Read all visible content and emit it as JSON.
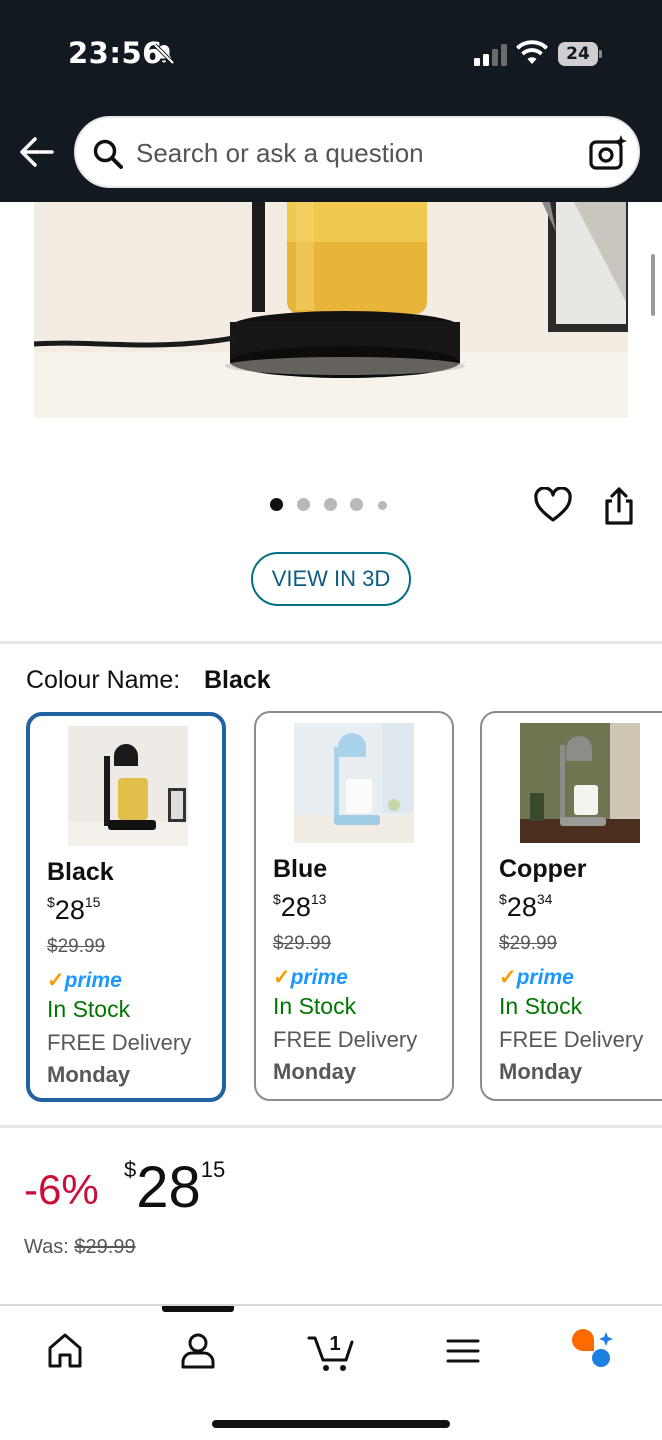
{
  "status_bar": {
    "time": "23:56",
    "battery_level": "24",
    "icons": [
      "bell-slash-icon",
      "cellular-signal-icon",
      "wifi-icon",
      "battery-icon"
    ]
  },
  "header": {
    "search_placeholder": "Search or ask a question",
    "icons": [
      "back-arrow-icon",
      "search-icon",
      "camera-search-icon"
    ]
  },
  "gallery": {
    "dot_count": 5,
    "active_dot": 1,
    "icons": [
      "heart-icon",
      "share-icon"
    ],
    "view_3d_label": "VIEW IN 3D"
  },
  "variations": {
    "label": "Colour Name:",
    "selected": "Black",
    "options": [
      {
        "name": "Black",
        "currency": "$",
        "whole": "28",
        "fraction": "15",
        "was": "$29.99",
        "prime": "prime",
        "stock": "In Stock",
        "delivery": "FREE Delivery",
        "day": "Monday",
        "selected": true
      },
      {
        "name": "Blue",
        "currency": "$",
        "whole": "28",
        "fraction": "13",
        "was": "$29.99",
        "prime": "prime",
        "stock": "In Stock",
        "delivery": "FREE Delivery",
        "day": "Monday",
        "selected": false
      },
      {
        "name": "Copper",
        "currency": "$",
        "whole": "28",
        "fraction": "34",
        "was": "$29.99",
        "prime": "prime",
        "stock": "In Stock",
        "delivery": "FREE Delivery",
        "day": "Monday",
        "selected": false
      }
    ]
  },
  "pricing": {
    "discount": "-6%",
    "currency": "$",
    "whole": "28",
    "fraction": "15",
    "was_label": "Was:",
    "was_price": "$29.99"
  },
  "bottom_nav": {
    "items": [
      "home-icon",
      "account-icon",
      "cart-icon",
      "menu-icon",
      "rufus-assistant-icon"
    ],
    "cart_count": "1"
  },
  "colors": {
    "header_bg": "#131921",
    "link": "#007185",
    "selected_border": "#2162a1",
    "deal_red": "#cc0c39",
    "in_stock_green": "#007600",
    "prime_blue": "#1a98ff",
    "prime_check": "#ff9900"
  }
}
